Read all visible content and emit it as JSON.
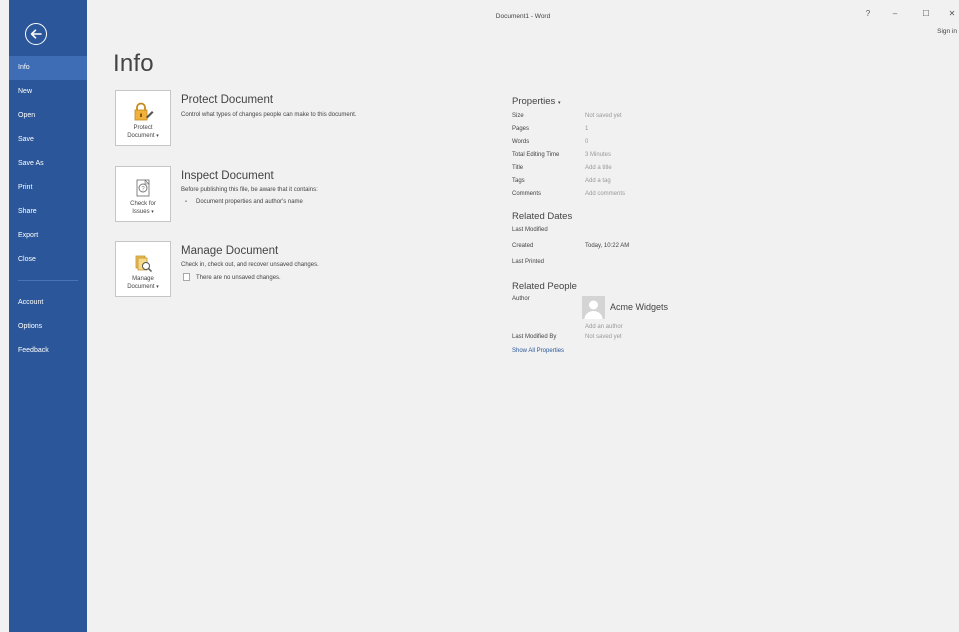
{
  "window": {
    "title": "Document1 - Word",
    "help": "?",
    "minimize": "–",
    "maximize": "☐",
    "close": "✕",
    "sign_in": "Sign in"
  },
  "sidebar": {
    "items": [
      {
        "label": "Info",
        "active": true
      },
      {
        "label": "New"
      },
      {
        "label": "Open"
      },
      {
        "label": "Save"
      },
      {
        "label": "Save As"
      },
      {
        "label": "Print"
      },
      {
        "label": "Share"
      },
      {
        "label": "Export"
      },
      {
        "label": "Close"
      }
    ],
    "bottom_items": [
      {
        "label": "Account"
      },
      {
        "label": "Options"
      },
      {
        "label": "Feedback"
      }
    ]
  },
  "main": {
    "title": "Info",
    "protect": {
      "tile_line1": "Protect",
      "tile_line2": "Document",
      "arrow": "▾",
      "title": "Protect Document",
      "desc": "Control what types of changes people can make to this document."
    },
    "inspect": {
      "tile_line1": "Check for",
      "tile_line2": "Issues",
      "arrow": "▾",
      "title": "Inspect Document",
      "desc": "Before publishing this file, be aware that it contains:",
      "bullet": "Document properties and author's name"
    },
    "manage": {
      "tile_line1": "Manage",
      "tile_line2": "Document",
      "arrow": "▾",
      "title": "Manage Document",
      "desc": "Check in, check out, and recover unsaved changes.",
      "note": "There are no unsaved changes."
    }
  },
  "properties": {
    "heading": "Properties",
    "arrow": "▾",
    "rows": [
      {
        "key": "Size",
        "value": "Not saved yet"
      },
      {
        "key": "Pages",
        "value": "1"
      },
      {
        "key": "Words",
        "value": "0"
      },
      {
        "key": "Total Editing Time",
        "value": "3 Minutes"
      },
      {
        "key": "Title",
        "value": "Add a title"
      },
      {
        "key": "Tags",
        "value": "Add a tag"
      },
      {
        "key": "Comments",
        "value": "Add comments"
      }
    ],
    "dates_heading": "Related Dates",
    "dates": [
      {
        "key": "Last Modified",
        "value": ""
      },
      {
        "key": "Created",
        "value": "Today, 10:22 AM"
      },
      {
        "key": "Last Printed",
        "value": ""
      }
    ],
    "people_heading": "Related People",
    "author_label": "Author",
    "author_name": "Acme Widgets",
    "add_author": "Add an author",
    "last_modified_by_label": "Last Modified By",
    "last_modified_by_value": "Not saved yet",
    "show_all": "Show All Properties"
  },
  "colors": {
    "sidebar": "#2b579a",
    "sidebar_active": "#3e6db5",
    "background": "#f1f1f1",
    "link": "#2b579a"
  }
}
